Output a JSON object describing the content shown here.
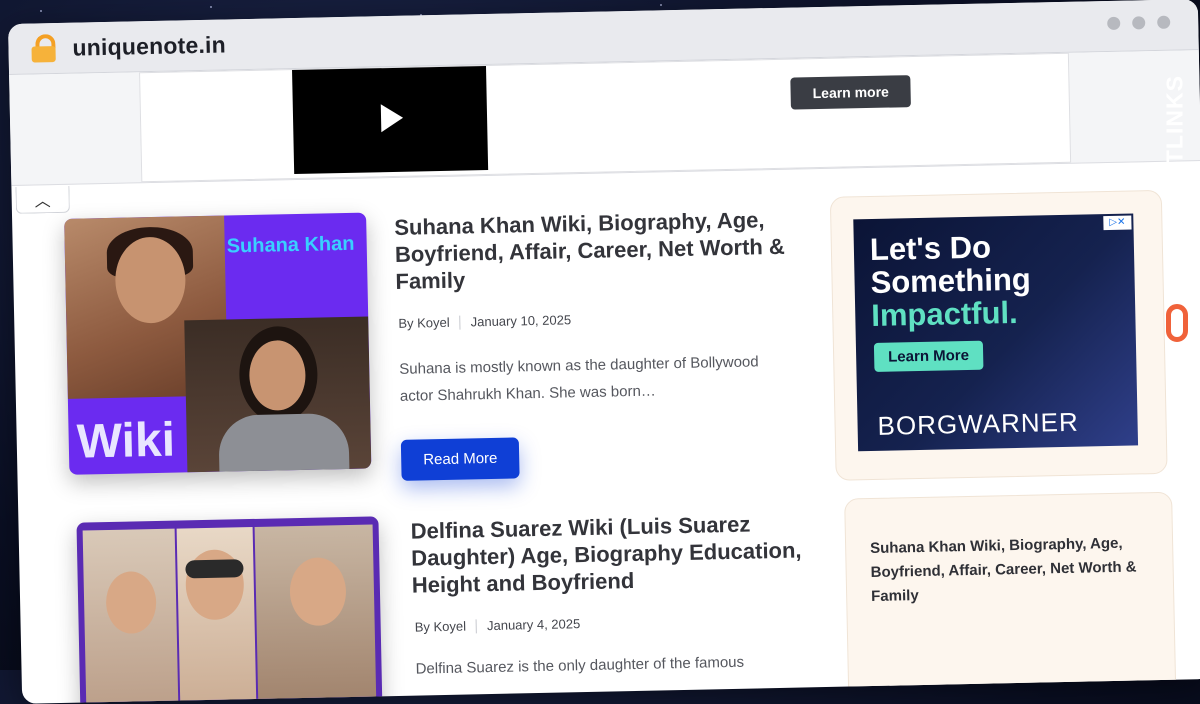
{
  "browser": {
    "url": "uniquenote.in"
  },
  "top_ad": {
    "button_label": "Learn more"
  },
  "posts": [
    {
      "title": "Suhana Khan Wiki, Biography, Age, Boyfriend, Affair, Career, Net Worth & Family",
      "author": "By Koyel",
      "date": "January 10, 2025",
      "excerpt": "Suhana is mostly known as the daughter of Bollywood actor Shahrukh Khan. She was born…",
      "read_more": "Read More",
      "image_text": {
        "name": "Suhana Khan",
        "tag": "Wiki"
      }
    },
    {
      "title": "Delfina Suarez Wiki (Luis Suarez Daughter) Age, Biography Education, Height and Boyfriend",
      "author": "By Koyel",
      "date": "January 4, 2025",
      "excerpt": "Delfina Suarez is the only daughter of the famous"
    }
  ],
  "side_ad": {
    "line1": "Let's Do",
    "line2": "Something",
    "line3": "Impactful.",
    "button": "Learn More",
    "brand": "BORGWARNER"
  },
  "sidebar": {
    "recent_title": "Suhana Khan Wiki, Biography, Age, Boyfriend, Affair, Career, Net Worth & Family"
  },
  "watermark": {
    "text": "GUESTPOSTLINKS"
  },
  "colors": {
    "accent": "#0f3fd6",
    "purple": "#6b2bf0",
    "teal": "#5fe0c2",
    "watermark_orange": "#f0623a"
  }
}
